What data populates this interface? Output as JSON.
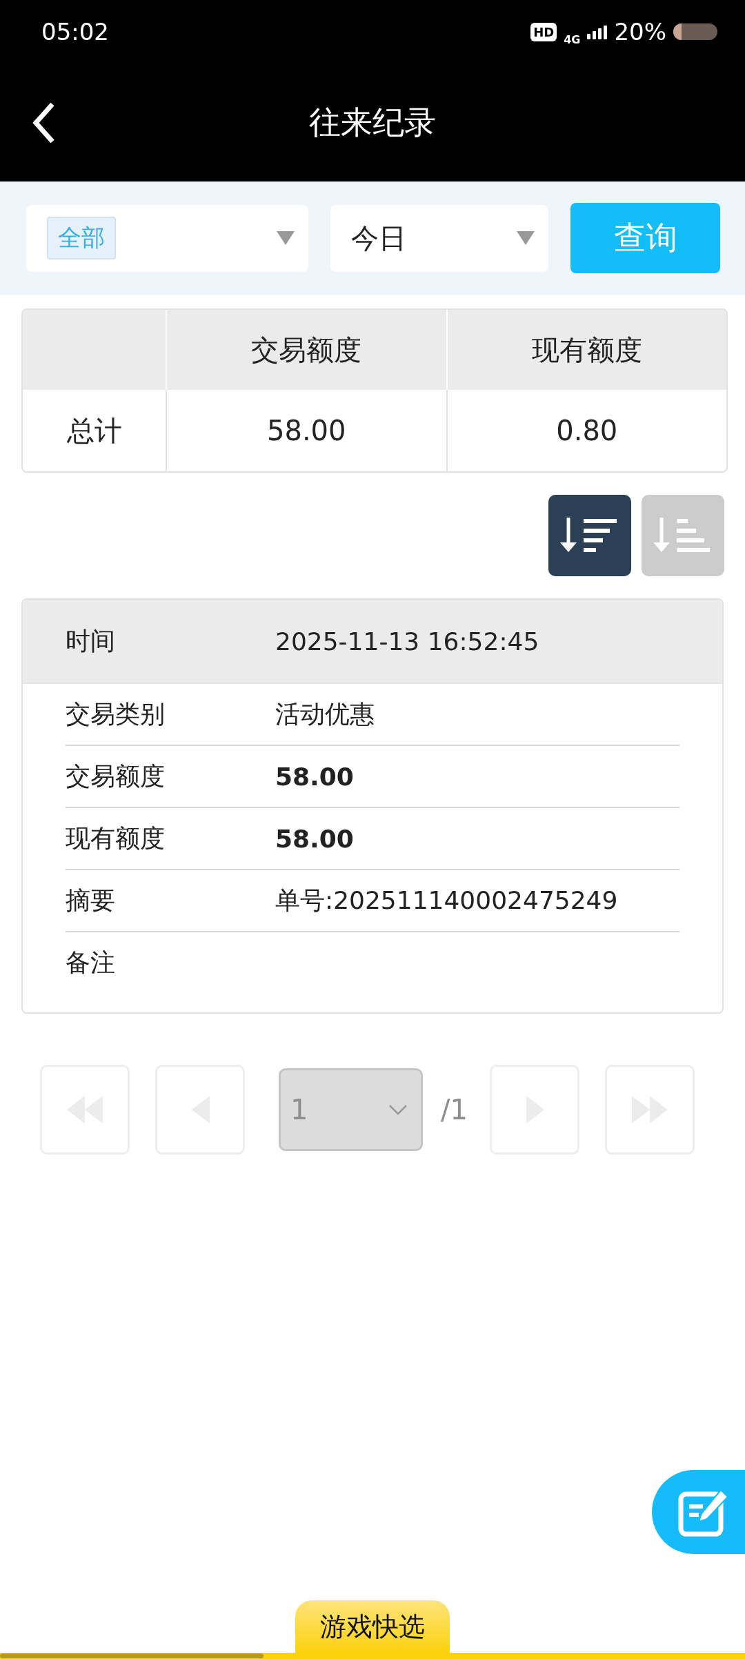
{
  "status_bar": {
    "time": "05:02",
    "hd": "HD",
    "network": "4G",
    "battery": "20%"
  },
  "header": {
    "title": "往来纪录"
  },
  "filters": {
    "category": {
      "value": "全部"
    },
    "period": {
      "value": "今日"
    },
    "query_button": "查询"
  },
  "summary": {
    "columns": [
      "交易额度",
      "现有额度"
    ],
    "rows": [
      {
        "label": "总计",
        "cells": [
          "58.00",
          "0.80"
        ]
      }
    ]
  },
  "sort_options": [
    {
      "kind": "descending",
      "selected": true
    },
    {
      "kind": "ascending",
      "selected": false
    }
  ],
  "record": {
    "rows": [
      {
        "kind": "header",
        "label": "时间",
        "value": "2025-11-13 16:52:45"
      },
      {
        "kind": "plain",
        "label": "交易类别",
        "value": "活动优惠"
      },
      {
        "kind": "bold",
        "label": "交易额度",
        "value": "58.00"
      },
      {
        "kind": "bold",
        "label": "现有额度",
        "value": "58.00"
      },
      {
        "kind": "plain",
        "label": "摘要",
        "value": "单号:202511140002475249"
      },
      {
        "kind": "plain",
        "label": "备注"
      }
    ]
  },
  "pagination": {
    "buttons": [
      {
        "kind": "first",
        "disabled": true
      },
      {
        "kind": "prev",
        "disabled": true
      },
      {
        "kind": "next",
        "disabled": true
      },
      {
        "kind": "last",
        "disabled": true
      }
    ],
    "page": "1",
    "total": "/1"
  },
  "bottom_tab": {
    "label": "游戏快选"
  }
}
